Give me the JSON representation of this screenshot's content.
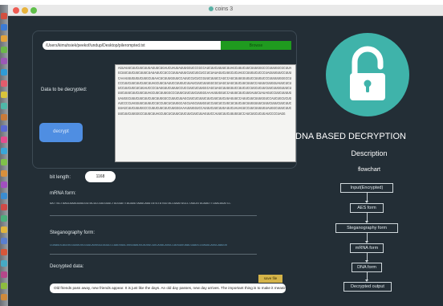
{
  "window": {
    "title": "coins 3"
  },
  "file_picker": {
    "path": "/Users/kimuhsiek/peekof/undup/Desktop/pilerompted.txt",
    "browse_label": "Browse"
  },
  "decrypt_panel": {
    "data_label": "Data to be decrypted:",
    "decrypt_button": "decrypt",
    "encrypted_data": "AGUAUUCUUCUUCUUGAGUUCUGAUCUAUUAUUUGGUCCCGCCAUCUUCUUUUCUUAGCUUUCUUCUUUGGGCCCUUUGGCGCUUAGCUUCUUCUUCUUUCUAUAUUCCUCCCUUUAUUUCUUCUGCUCCUCUAUAGUCUUGCUCUAGCCUUGUCUCCCUAGUUGUUCCUUUCAAAUUUGUGUCUUGCUUAACUCUUUGGUUCCAUUCCUCUCCGUUCUUUCCAGCCAGCUUUGGUGUCCUUGUCCCUUUUUGGGCCUCCCUUCUUCUUCUUCUUAGCUUCUAUUCCUUGUCUUAUCUUCUUUGGCGCUAGCUAGCUUCUUCUUUCCAUUUCUUGGUAUUCUCUUCCUUCUGCUCUGAUCCCCUAGGUUCUUUUCCUCCUUCUCUUGGCAGCUAGCUUUGGUCCUUCUCCUGCUCUUCUUCUUGGUUUCUUUCUUUCUUCUUCUUAGCUUCUUUGGCCCUUUCUUCUUCUUGGGAAAUUUGGUCCAUUUCUUCUUGAUUCUAUAGUCCUUCUUUUGUAUGGCUUUCUUCUUCUUCUUGGGCCUUUCUUAGCUUCUCUUUCUUCUUCUUCUUAGUUCCAUUCUUCUUUGGUCCAUCUGCUCUGAUCCCCUAGGUUCUUUUCCUCCUUCUCUUGGCAGCUAGCUUUGGUCCUUCUCCUGCUCUUCUUCUUGGUUUCUUUCUUUCUUCUUCUUAGCUUCUUUGGCCCUUUCUUCUUCUUGGGAAAUUUGGUCCAUUUCUUCUUGAUUCUAUAGUCCUUCUUUUGUAUGGCUUUCUUCUUCUUCUUGGGCCUUUCUUAGCUUCUCUUUCUUCUUCUUCUUAGUUCCAUUCUUCUUUGGUCCAUCUGCUCUGAUCCCCUAGG"
  },
  "bit_length": {
    "label": "bit length:",
    "value": "1168"
  },
  "mrna": {
    "label": "mRNA form:",
    "sequence": "GATTGCTAAGCAAACAAGCGGTACGCCGGCGGGCTGCGGATTACAAGTAAGCAGGTATGTATGGTACCGAATGGCCTAGCATGCAAGTTCAACGGATCC"
  },
  "steganography": {
    "label": "Steganography form:",
    "sequence": "CUAAGUCAGUUCGGUAUUCGGGCAUUGGCGGGCCCGAUUGGCUUGUAAUUCAUUGCGUCAUACAUGCCAUGGUUAACGGAUCCUAGGCAUGCAAGUU"
  },
  "decrypted": {
    "label": "Decrypted data:",
    "save_button": "save file",
    "output": "Old friends pass away, new friends appear. It is just like the days. An old day passes, new day arrives. The important thing is to make it meaningful."
  },
  "sidebar": {
    "app_title": "DNA BASED DECRYPTION",
    "description_title": "Description",
    "flowchart_title": "flowchart",
    "steps": [
      "Input(Encrypted)",
      "AES form",
      "Steganography form",
      "mRNA form",
      "DNA form",
      "Decrypted output"
    ]
  }
}
